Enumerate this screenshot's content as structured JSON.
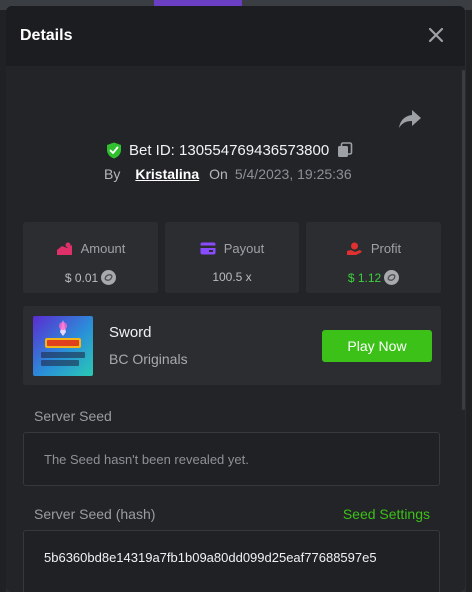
{
  "modal": {
    "title": "Details"
  },
  "bet": {
    "id_label": "Bet ID:",
    "id": "130554769436573800",
    "by_label": "By",
    "user": "Kristalina",
    "on_label": "On",
    "date": "5/4/2023, 19:25:36"
  },
  "stats": {
    "amount": {
      "label": "Amount",
      "value": "$ 0.01"
    },
    "payout": {
      "label": "Payout",
      "value": "100.5 x"
    },
    "profit": {
      "label": "Profit",
      "value": "$ 1.12"
    }
  },
  "game": {
    "name": "Sword",
    "provider": "BC Originals",
    "play_label": "Play Now"
  },
  "server_seed": {
    "label": "Server Seed",
    "placeholder": "The Seed hasn't been revealed yet."
  },
  "server_seed_hash": {
    "label": "Server Seed (hash)",
    "settings_label": "Seed Settings",
    "value": "5b6360bd8e14319a7fb1b09a80dd099d25eaf77688597e5"
  },
  "colors": {
    "accent_green": "#3bc117",
    "profit_green": "#3bd13b",
    "verified_green": "#2fbf2f",
    "amount_icon": "#e0306a",
    "payout_icon": "#8a4bff",
    "profit_icon": "#e03030"
  },
  "icons": {
    "close": "close-icon",
    "share": "share-icon",
    "verified": "shield-check-icon",
    "copy": "copy-icon",
    "amount": "bet-amount-icon",
    "payout": "payout-icon",
    "profit": "profit-icon",
    "coin": "coin-icon"
  }
}
